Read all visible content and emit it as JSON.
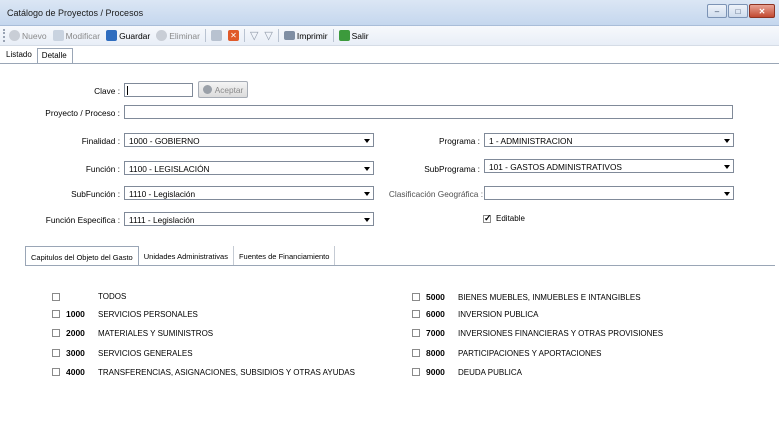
{
  "window": {
    "title": "Catálogo de Proyectos / Procesos"
  },
  "toolbar": {
    "nuevo": "Nuevo",
    "modificar": "Modificar",
    "guardar": "Guardar",
    "eliminar": "Eliminar",
    "imprimir": "Imprimir",
    "salir": "Salir"
  },
  "tabs": {
    "listado": "Listado",
    "detalle": "Detalle"
  },
  "form": {
    "clave_label": "Clave :",
    "clave_value": "",
    "aceptar": "Aceptar",
    "proyecto_label": "Proyecto / Proceso :",
    "proyecto_value": "",
    "finalidad_label": "Finalidad :",
    "finalidad_value": "1000 - GOBIERNO",
    "funcion_label": "Función :",
    "funcion_value": "1100 - LEGISLACIÓN",
    "subfuncion_label": "SubFunción :",
    "subfuncion_value": "1110 - Legislación",
    "funcion_esp_label": "Función Especifica :",
    "funcion_esp_value": "1111 - Legislación",
    "programa_label": "Programa :",
    "programa_value": "1 - ADMINISTRACION",
    "subprograma_label": "SubPrograma :",
    "subprograma_value": "101 - GASTOS ADMINISTRATIVOS",
    "clasif_label": "Clasificación Geográfica :",
    "clasif_value": "",
    "editable_label": "Editable",
    "editable_checked": true
  },
  "subtabs": [
    "Capitulos del Objeto del Gasto",
    "Unidades Administrativas",
    "Fuentes de Financiamiento"
  ],
  "capitulos_left": [
    {
      "code": "",
      "name": "TODOS"
    },
    {
      "code": "1000",
      "name": "SERVICIOS PERSONALES"
    },
    {
      "code": "2000",
      "name": "MATERIALES Y SUMINISTROS"
    },
    {
      "code": "3000",
      "name": "SERVICIOS GENERALES"
    },
    {
      "code": "4000",
      "name": "TRANSFERENCIAS, ASIGNACIONES, SUBSIDIOS Y OTRAS AYUDAS"
    }
  ],
  "capitulos_right": [
    {
      "code": "5000",
      "name": "BIENES MUEBLES, INMUEBLES E INTANGIBLES"
    },
    {
      "code": "6000",
      "name": "INVERSION PUBLICA"
    },
    {
      "code": "7000",
      "name": "INVERSIONES FINANCIERAS Y OTRAS PROVISIONES"
    },
    {
      "code": "8000",
      "name": "PARTICIPACIONES Y APORTACIONES"
    },
    {
      "code": "9000",
      "name": "DEUDA PUBLICA"
    }
  ]
}
